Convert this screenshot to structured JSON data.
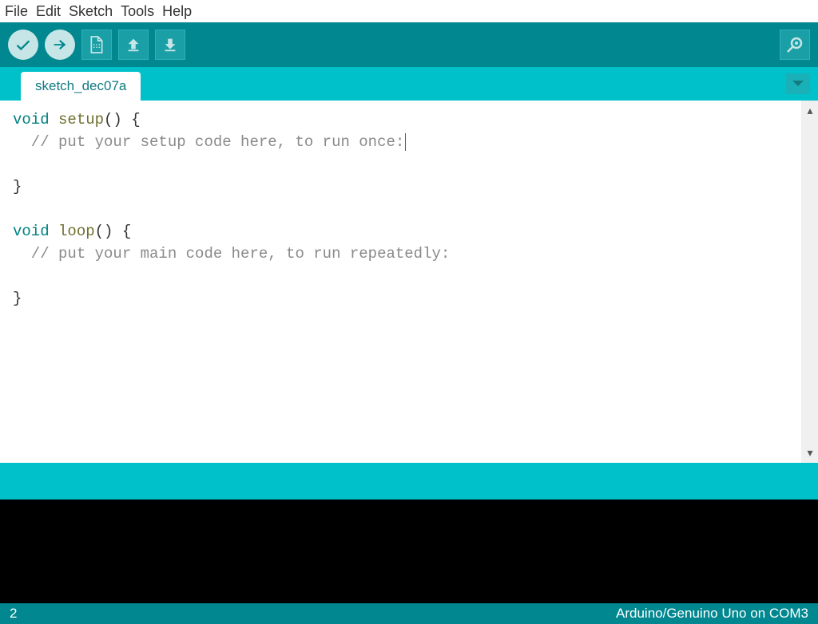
{
  "menubar": {
    "items": [
      "File",
      "Edit",
      "Sketch",
      "Tools",
      "Help"
    ]
  },
  "toolbar": {
    "verify": "verify",
    "upload": "upload",
    "new": "new",
    "open": "open",
    "save": "save",
    "serial": "serial-monitor"
  },
  "tabs": {
    "active": "sketch_dec07a"
  },
  "editor": {
    "line1_kw": "void",
    "line1_fn": " setup",
    "line1_rest": "() {",
    "line2_cm": "  // put your setup code here, to run once:",
    "line3": "",
    "line4": "}",
    "line5": "",
    "line6_kw": "void",
    "line6_fn": " loop",
    "line6_rest": "() {",
    "line7_cm": "  // put your main code here, to run repeatedly:",
    "line8": "",
    "line9": "}"
  },
  "footer": {
    "line": "2",
    "board": "Arduino/Genuino Uno on COM3"
  }
}
